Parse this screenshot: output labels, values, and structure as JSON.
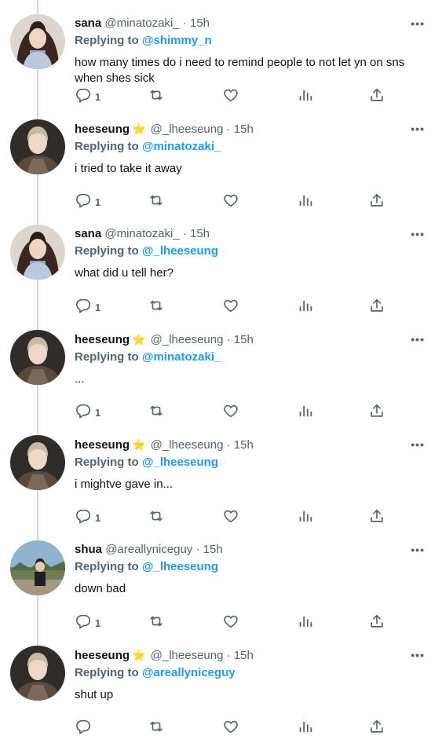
{
  "tweets": [
    {
      "name": "sana",
      "star": false,
      "handle": "@minatozaki_",
      "time": "15h",
      "reply_label": "Replying to",
      "reply_to": "@shimmy_n",
      "text": "how many times do i need to remind people to not let yn on sns when shes sick",
      "reply_count": "1",
      "avatar": "sana-avatar"
    },
    {
      "name": "heeseung",
      "star": true,
      "handle": "@_lheeseung",
      "time": "15h",
      "reply_label": "Replying to",
      "reply_to": "@minatozaki_",
      "text": "i tried to take it away",
      "reply_count": "1",
      "avatar": "heeseung-avatar"
    },
    {
      "name": "sana",
      "star": false,
      "handle": "@minatozaki_",
      "time": "15h",
      "reply_label": "Replying to",
      "reply_to": "@_lheeseung",
      "text": "what did u tell her?",
      "reply_count": "1",
      "avatar": "sana-avatar"
    },
    {
      "name": "heeseung",
      "star": true,
      "handle": "@_lheeseung",
      "time": "15h",
      "reply_label": "Replying to",
      "reply_to": "@minatozaki_",
      "text": "...",
      "reply_count": "1",
      "avatar": "heeseung-avatar"
    },
    {
      "name": "heeseung",
      "star": true,
      "handle": "@_lheeseung",
      "time": "15h",
      "reply_label": "Replying to",
      "reply_to": "@_lheeseung",
      "text": "i mightve gave in...",
      "reply_count": "1",
      "avatar": "heeseung-avatar"
    },
    {
      "name": "shua",
      "star": false,
      "handle": "@areallyniceguy",
      "time": "15h",
      "reply_label": "Replying to",
      "reply_to": "@_lheeseung",
      "text": "down bad",
      "reply_count": "1",
      "avatar": "shua-avatar"
    },
    {
      "name": "heeseung",
      "star": true,
      "handle": "@_lheeseung",
      "time": "15h",
      "reply_label": "Replying to",
      "reply_to": "@areallyniceguy",
      "text": "shut up",
      "reply_count": "",
      "avatar": "heeseung-avatar"
    }
  ],
  "symbols": {
    "star": "⭐",
    "dot": "·",
    "more": "•••"
  },
  "colors": {
    "link": "#1d9bf0",
    "muted": "#536471",
    "text": "#0f1419",
    "thread_line": "#cfd9de"
  }
}
